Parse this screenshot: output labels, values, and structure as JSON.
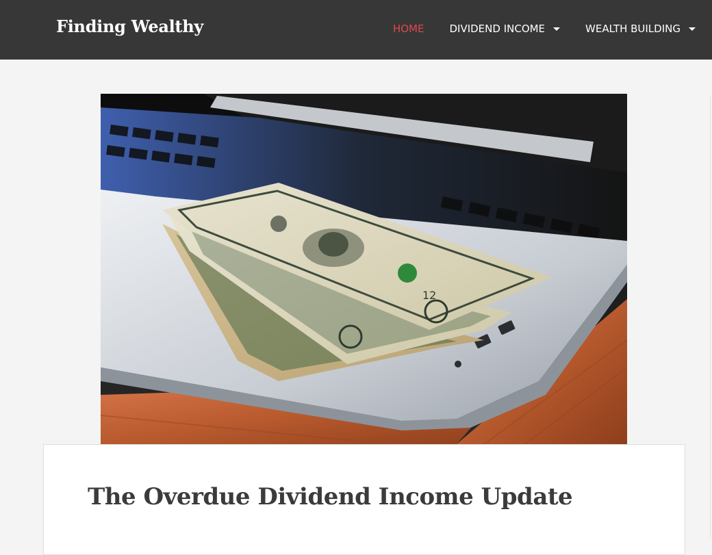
{
  "site": {
    "title": "Finding Wealthy"
  },
  "nav": {
    "items": [
      {
        "label": "HOME",
        "active": true,
        "has_dropdown": false
      },
      {
        "label": "DIVIDEND INCOME",
        "active": false,
        "has_dropdown": true
      },
      {
        "label": "WEALTH BUILDING",
        "active": false,
        "has_dropdown": true
      }
    ]
  },
  "hero": {
    "icon": "photo-laptop-with-dollar-bills"
  },
  "post": {
    "title": "The Overdue Dividend Income Update"
  },
  "colors": {
    "header_bg": "#373737",
    "accent": "#e0474c",
    "page_bg": "#f4f4f4",
    "title_text": "#3b3b3b"
  }
}
